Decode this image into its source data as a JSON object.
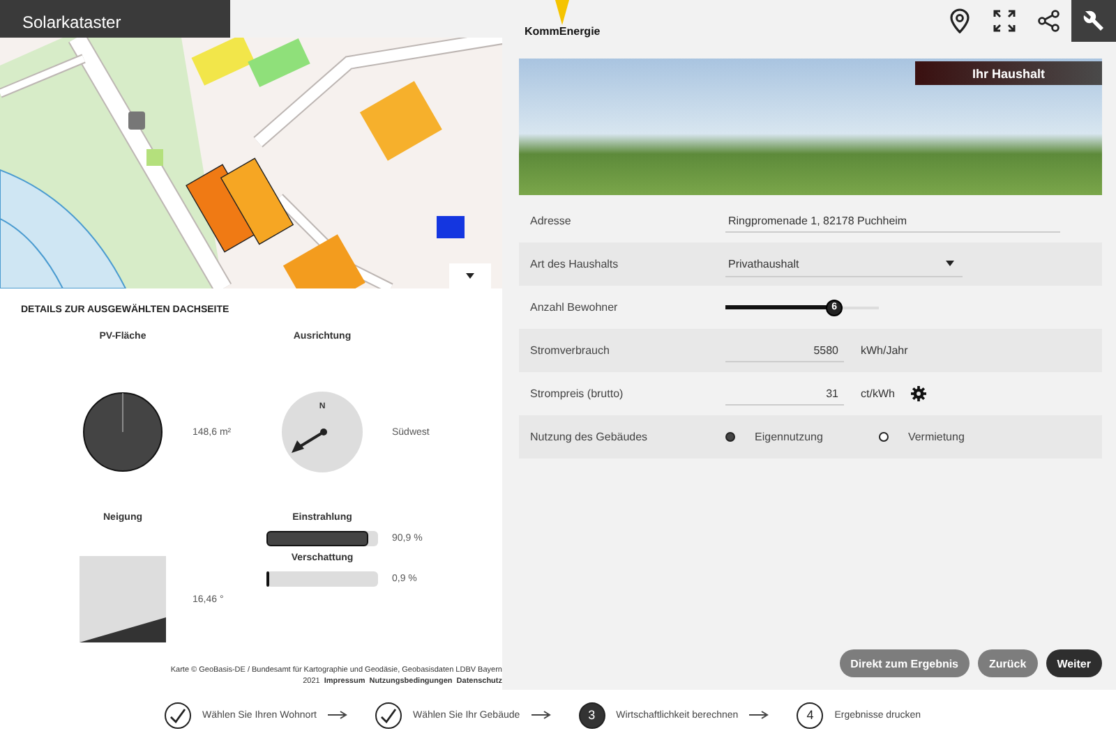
{
  "app_bar": {
    "title": "Solarkataster"
  },
  "details": {
    "title": "DETAILS ZUR AUSGEWÄHLTEN DACHSEITE",
    "pv_area": {
      "label": "PV-Fläche",
      "value": "148,6 m²"
    },
    "orientation": {
      "label": "Ausrichtung",
      "compass_letter": "N",
      "value": "Südwest"
    },
    "tilt": {
      "label": "Neigung",
      "value": "16,46 °"
    },
    "meters": [
      {
        "label": "Einstrahlung",
        "level": 0.909,
        "reading": "90,9 %"
      },
      {
        "label": "Verschattung",
        "level": 0.009,
        "reading": "0,9 %"
      }
    ]
  },
  "attribution": {
    "text": "Karte © GeoBasis-DE / Bundesamt für Kartographie und Geodäsie, Geobasisdaten LDBV Bayern",
    "year": "2021",
    "links": [
      "Impressum",
      "Nutzungsbedingungen",
      "Datenschutz"
    ]
  },
  "brand": {
    "name": "KommEnergie"
  },
  "toolbar": [
    {
      "kind": "location",
      "selected": false
    },
    {
      "kind": "fullscreen",
      "selected": false
    },
    {
      "kind": "share",
      "selected": false
    },
    {
      "kind": "tools",
      "selected": true
    }
  ],
  "banner": {
    "title": "Ihr Haushalt"
  },
  "form": [
    {
      "kind": "text",
      "label": "Adresse",
      "value": "Ringpromenade 1, 82178 Puchheim"
    },
    {
      "kind": "select",
      "label": "Art des Haushalts",
      "value": "Privathaushalt"
    },
    {
      "kind": "slider",
      "label": "Anzahl Bewohner",
      "value": "6",
      "level": 0.71
    },
    {
      "kind": "number",
      "label": "Stromverbrauch",
      "value": "5580",
      "unit": "kWh/Jahr"
    },
    {
      "kind": "number",
      "label": "Strompreis (brutto)",
      "value": "31",
      "unit": "ct/kWh",
      "settings": true
    },
    {
      "kind": "radio",
      "label": "Nutzung des Gebäudes",
      "options": [
        {
          "label": "Eigennutzung",
          "selected": true
        },
        {
          "label": "Vermietung",
          "selected": false
        }
      ]
    }
  ],
  "actions": [
    {
      "label": "Direkt zum Ergebnis",
      "kind": "secondary"
    },
    {
      "label": "Zurück",
      "kind": "secondary"
    },
    {
      "label": "Weiter",
      "kind": "primary"
    }
  ],
  "steps": [
    {
      "done": true,
      "selected": false,
      "label": "Wählen Sie Ihren Wohnort"
    },
    {
      "done": true,
      "selected": false,
      "label": "Wählen Sie Ihr Gebäude"
    },
    {
      "done": false,
      "selected": true,
      "number": "3",
      "label": "Wirtschaftlichkeit berechnen"
    },
    {
      "done": false,
      "selected": false,
      "number": "4",
      "label": "Ergebnisse drucken"
    }
  ]
}
